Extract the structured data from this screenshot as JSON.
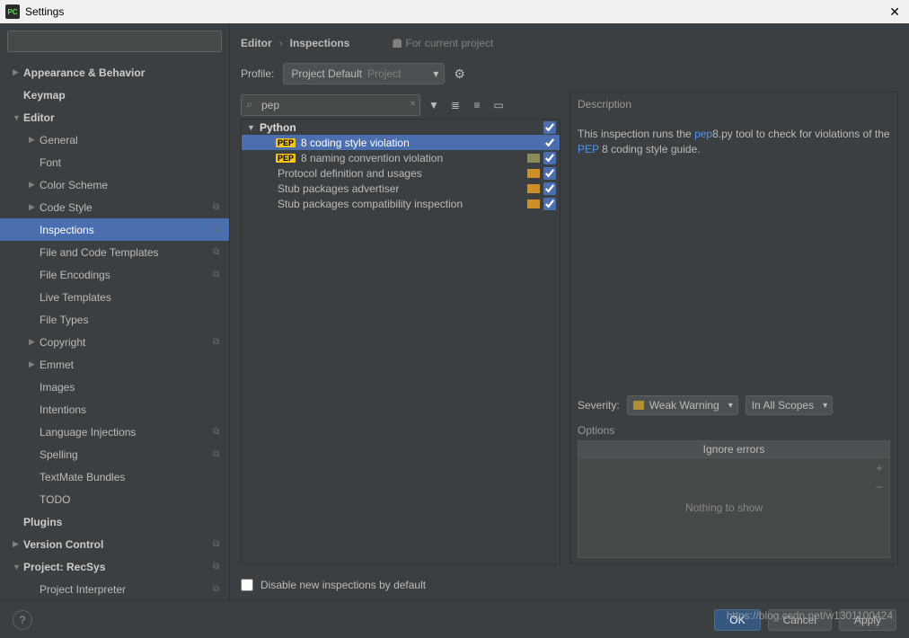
{
  "window": {
    "title": "Settings"
  },
  "breadcrumb": {
    "a": "Editor",
    "b": "Inspections",
    "for_project": "For current project"
  },
  "profile": {
    "label": "Profile:",
    "value": "Project Default",
    "scope": "Project"
  },
  "sidebar": {
    "items": [
      {
        "label": "Appearance & Behavior",
        "arrow": "▶",
        "level": 0,
        "bold": true
      },
      {
        "label": "Keymap",
        "arrow": "",
        "level": 0,
        "bold": true
      },
      {
        "label": "Editor",
        "arrow": "▼",
        "level": 0,
        "bold": true
      },
      {
        "label": "General",
        "arrow": "▶",
        "level": 1
      },
      {
        "label": "Font",
        "arrow": "",
        "level": 1
      },
      {
        "label": "Color Scheme",
        "arrow": "▶",
        "level": 1
      },
      {
        "label": "Code Style",
        "arrow": "▶",
        "level": 1,
        "icon": true
      },
      {
        "label": "Inspections",
        "arrow": "",
        "level": 1,
        "icon": true,
        "selected": true
      },
      {
        "label": "File and Code Templates",
        "arrow": "",
        "level": 1,
        "icon": true
      },
      {
        "label": "File Encodings",
        "arrow": "",
        "level": 1,
        "icon": true
      },
      {
        "label": "Live Templates",
        "arrow": "",
        "level": 1
      },
      {
        "label": "File Types",
        "arrow": "",
        "level": 1
      },
      {
        "label": "Copyright",
        "arrow": "▶",
        "level": 1,
        "icon": true
      },
      {
        "label": "Emmet",
        "arrow": "▶",
        "level": 1
      },
      {
        "label": "Images",
        "arrow": "",
        "level": 1
      },
      {
        "label": "Intentions",
        "arrow": "",
        "level": 1
      },
      {
        "label": "Language Injections",
        "arrow": "",
        "level": 1,
        "icon": true
      },
      {
        "label": "Spelling",
        "arrow": "",
        "level": 1,
        "icon": true
      },
      {
        "label": "TextMate Bundles",
        "arrow": "",
        "level": 1
      },
      {
        "label": "TODO",
        "arrow": "",
        "level": 1
      },
      {
        "label": "Plugins",
        "arrow": "",
        "level": 0,
        "bold": true
      },
      {
        "label": "Version Control",
        "arrow": "▶",
        "level": 0,
        "bold": true,
        "icon": true
      },
      {
        "label": "Project: RecSys",
        "arrow": "▼",
        "level": 0,
        "bold": true,
        "icon": true
      },
      {
        "label": "Project Interpreter",
        "arrow": "",
        "level": 1,
        "icon": true
      }
    ]
  },
  "inspections": {
    "search": "pep",
    "group": "Python",
    "rows": [
      {
        "badge": "PEP",
        "text": "8 coding style violation",
        "color": "#4b6eaf",
        "checked": true,
        "selected": true
      },
      {
        "badge": "PEP",
        "text": "8 naming convention violation",
        "color": "#8a8a5c",
        "checked": true
      },
      {
        "badge": "",
        "text": "Protocol definition and usages",
        "color": "#cc8f29",
        "checked": true
      },
      {
        "badge": "",
        "text": "Stub packages advertiser",
        "color": "#cc8f29",
        "checked": true
      },
      {
        "badge": "",
        "text": "Stub packages compatibility inspection",
        "color": "#cc8f29",
        "checked": true
      }
    ]
  },
  "description": {
    "label": "Description",
    "pre": "This inspection runs the ",
    "hl1": "pep",
    "mid1": "8.py tool to check for violations of the ",
    "hl2": "PEP",
    "post": " 8 coding style guide."
  },
  "severity": {
    "label": "Severity:",
    "value": "Weak Warning",
    "scope": "In All Scopes"
  },
  "options": {
    "label": "Options",
    "header": "Ignore errors",
    "empty": "Nothing to show"
  },
  "disable": {
    "label": "Disable new inspections by default"
  },
  "footer": {
    "ok": "OK",
    "cancel": "Cancel",
    "apply": "Apply"
  },
  "watermark": "https://blog.csdn.net/w1301100424"
}
